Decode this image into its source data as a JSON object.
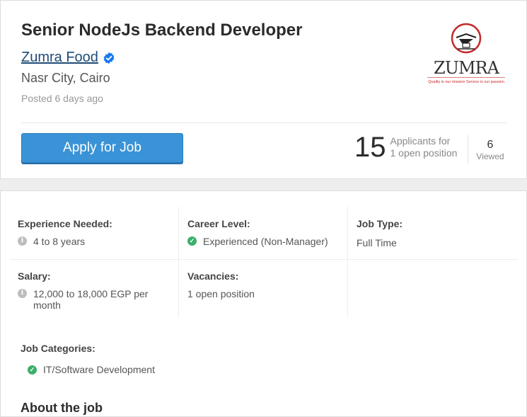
{
  "job": {
    "title": "Senior NodeJs Backend Developer",
    "company": "Zumra Food",
    "location": "Nasr City, Cairo",
    "posted": "Posted 6 days ago"
  },
  "logo": {
    "brand": "ZUMRA",
    "tagline": "Quality is our mission Service is our passion"
  },
  "apply": {
    "label": "Apply for Job"
  },
  "stats": {
    "applicants_count": "15",
    "applicants_line1": "Applicants for",
    "applicants_line2": "1 open position",
    "viewed_count": "6",
    "viewed_label": "Viewed"
  },
  "details": {
    "experience": {
      "label": "Experience Needed:",
      "value": "4 to 8 years",
      "icon": "info-icon"
    },
    "career": {
      "label": "Career Level:",
      "value": "Experienced (Non-Manager)",
      "icon": "check-icon"
    },
    "jobtype": {
      "label": "Job Type:",
      "value": "Full Time"
    },
    "salary": {
      "label": "Salary:",
      "value": "12,000 to 18,000 EGP per month",
      "icon": "info-icon"
    },
    "vacancies": {
      "label": "Vacancies:",
      "value": "1 open position"
    }
  },
  "categories": {
    "label": "Job Categories:",
    "items": [
      "IT/Software Development"
    ]
  },
  "about": {
    "label": "About the job"
  },
  "colors": {
    "accent": "#3a93d6",
    "link": "#1f4a75",
    "verified": "#1877f2",
    "check": "#3bb06a"
  }
}
